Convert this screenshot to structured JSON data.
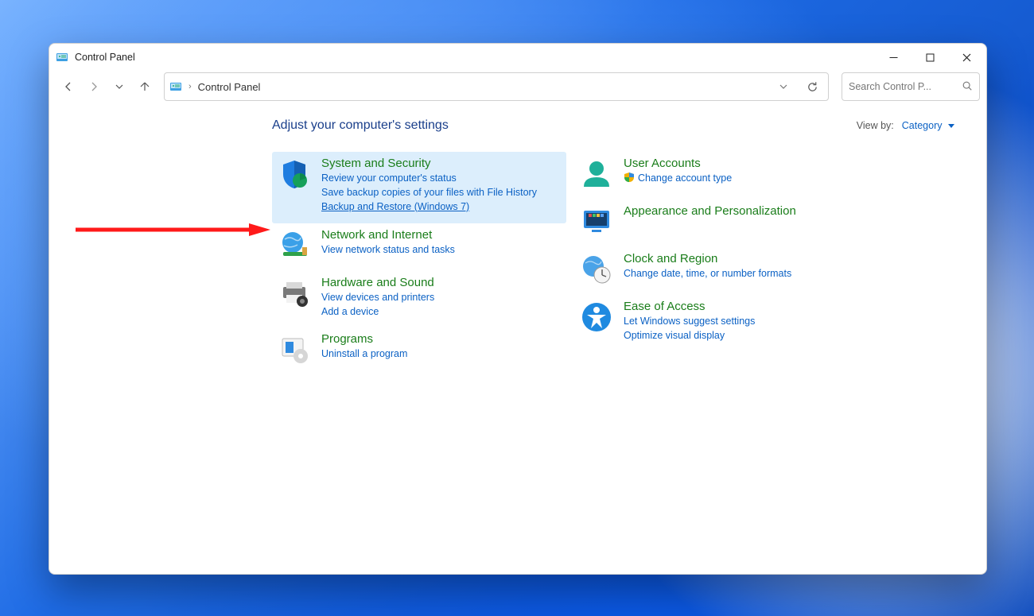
{
  "window": {
    "title": "Control Panel"
  },
  "address": {
    "crumb": "Control Panel"
  },
  "search": {
    "placeholder": "Search Control P..."
  },
  "heading": "Adjust your computer's settings",
  "viewby": {
    "label": "View by:",
    "value": "Category"
  },
  "left_column": [
    {
      "id": "system-security",
      "title": "System and Security",
      "highlight": true,
      "links": [
        {
          "text": "Review your computer's status"
        },
        {
          "text": "Save backup copies of your files with File History"
        },
        {
          "text": "Backup and Restore (Windows 7)",
          "underlined": true
        }
      ]
    },
    {
      "id": "network-internet",
      "title": "Network and Internet",
      "links": [
        {
          "text": "View network status and tasks"
        }
      ]
    },
    {
      "id": "hardware-sound",
      "title": "Hardware and Sound",
      "links": [
        {
          "text": "View devices and printers"
        },
        {
          "text": "Add a device"
        }
      ]
    },
    {
      "id": "programs",
      "title": "Programs",
      "links": [
        {
          "text": "Uninstall a program"
        }
      ]
    }
  ],
  "right_column": [
    {
      "id": "user-accounts",
      "title": "User Accounts",
      "links": [
        {
          "text": "Change account type",
          "shield": true
        }
      ]
    },
    {
      "id": "appearance",
      "title": "Appearance and Personalization",
      "links": []
    },
    {
      "id": "clock-region",
      "title": "Clock and Region",
      "links": [
        {
          "text": "Change date, time, or number formats"
        }
      ]
    },
    {
      "id": "ease-of-access",
      "title": "Ease of Access",
      "links": [
        {
          "text": "Let Windows suggest settings"
        },
        {
          "text": "Optimize visual display"
        }
      ]
    }
  ]
}
